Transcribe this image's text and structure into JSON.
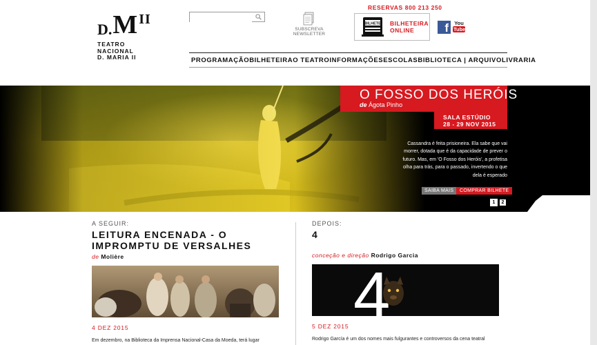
{
  "header": {
    "logo_mark_d": "D.",
    "logo_mark_m": "M",
    "logo_mark_ii": "II",
    "logo_line1": "TEATRO",
    "logo_line2": "NACIONAL",
    "logo_line3": "D. MARIA II",
    "search_placeholder": "",
    "newsletter_line1": "SUBSCREVA",
    "newsletter_line2": "NEWSLETTER",
    "reservas": "RESERVAS 800 213 250",
    "ticket_line1": "BILHETEIRA",
    "ticket_line2": "ONLINE",
    "ticket_icon_label": "BILHETE",
    "facebook_label": "f",
    "youtube_you": "You",
    "youtube_tube": "Tube"
  },
  "nav": {
    "items": [
      "PROGRAMAÇÃO",
      "BILHETEIRA",
      "O TEATRO",
      "INFORMAÇÕES",
      "ESCOLAS",
      "BIBLIOTECA | ARQUIVO",
      "LIVRARIA"
    ]
  },
  "hero": {
    "title": "O FOSSO DOS HERÓIS",
    "author_prefix": "de",
    "author": "Ágota Pinho",
    "venue": "SALA ESTÚDIO",
    "dates": "28 - 29 NOV 2015",
    "description": "Cassandra é feita prisioneira. Ela sabe que vai morrer, dotada que é da capacidade de prever o futuro. Mas, em 'O Fosso dos Heróis', a profetisa olha para trás, para o passado, invertendo o que dela é esperado",
    "btn_saiba": "SAIBA MAIS",
    "btn_comprar": "COMPRAR BILHETE",
    "pages": [
      "1",
      "2"
    ]
  },
  "next": {
    "kicker": "A SEGUIR:",
    "title": "LEITURA ENCENADA - O IMPROMPTU DE VERSALHES",
    "by_label": "de",
    "by_name": "Molière",
    "date": "4 DEZ 2015",
    "body": "Em dezembro, na Biblioteca da Imprensa Nacional-Casa da Moeda, terá lugar"
  },
  "after": {
    "kicker": "DEPOIS:",
    "title": "4",
    "by_label": "conceção e direção",
    "by_name": "Rodrigo Garcia",
    "image_number": "4",
    "date": "5 DEZ 2015",
    "body": "Rodrigo García é um dos nomes mais fulgurantes e controversos da cena teatral"
  },
  "colors": {
    "accent_red": "#d71920",
    "hero_yellow": "#f2d21a",
    "text_dark": "#111111"
  }
}
